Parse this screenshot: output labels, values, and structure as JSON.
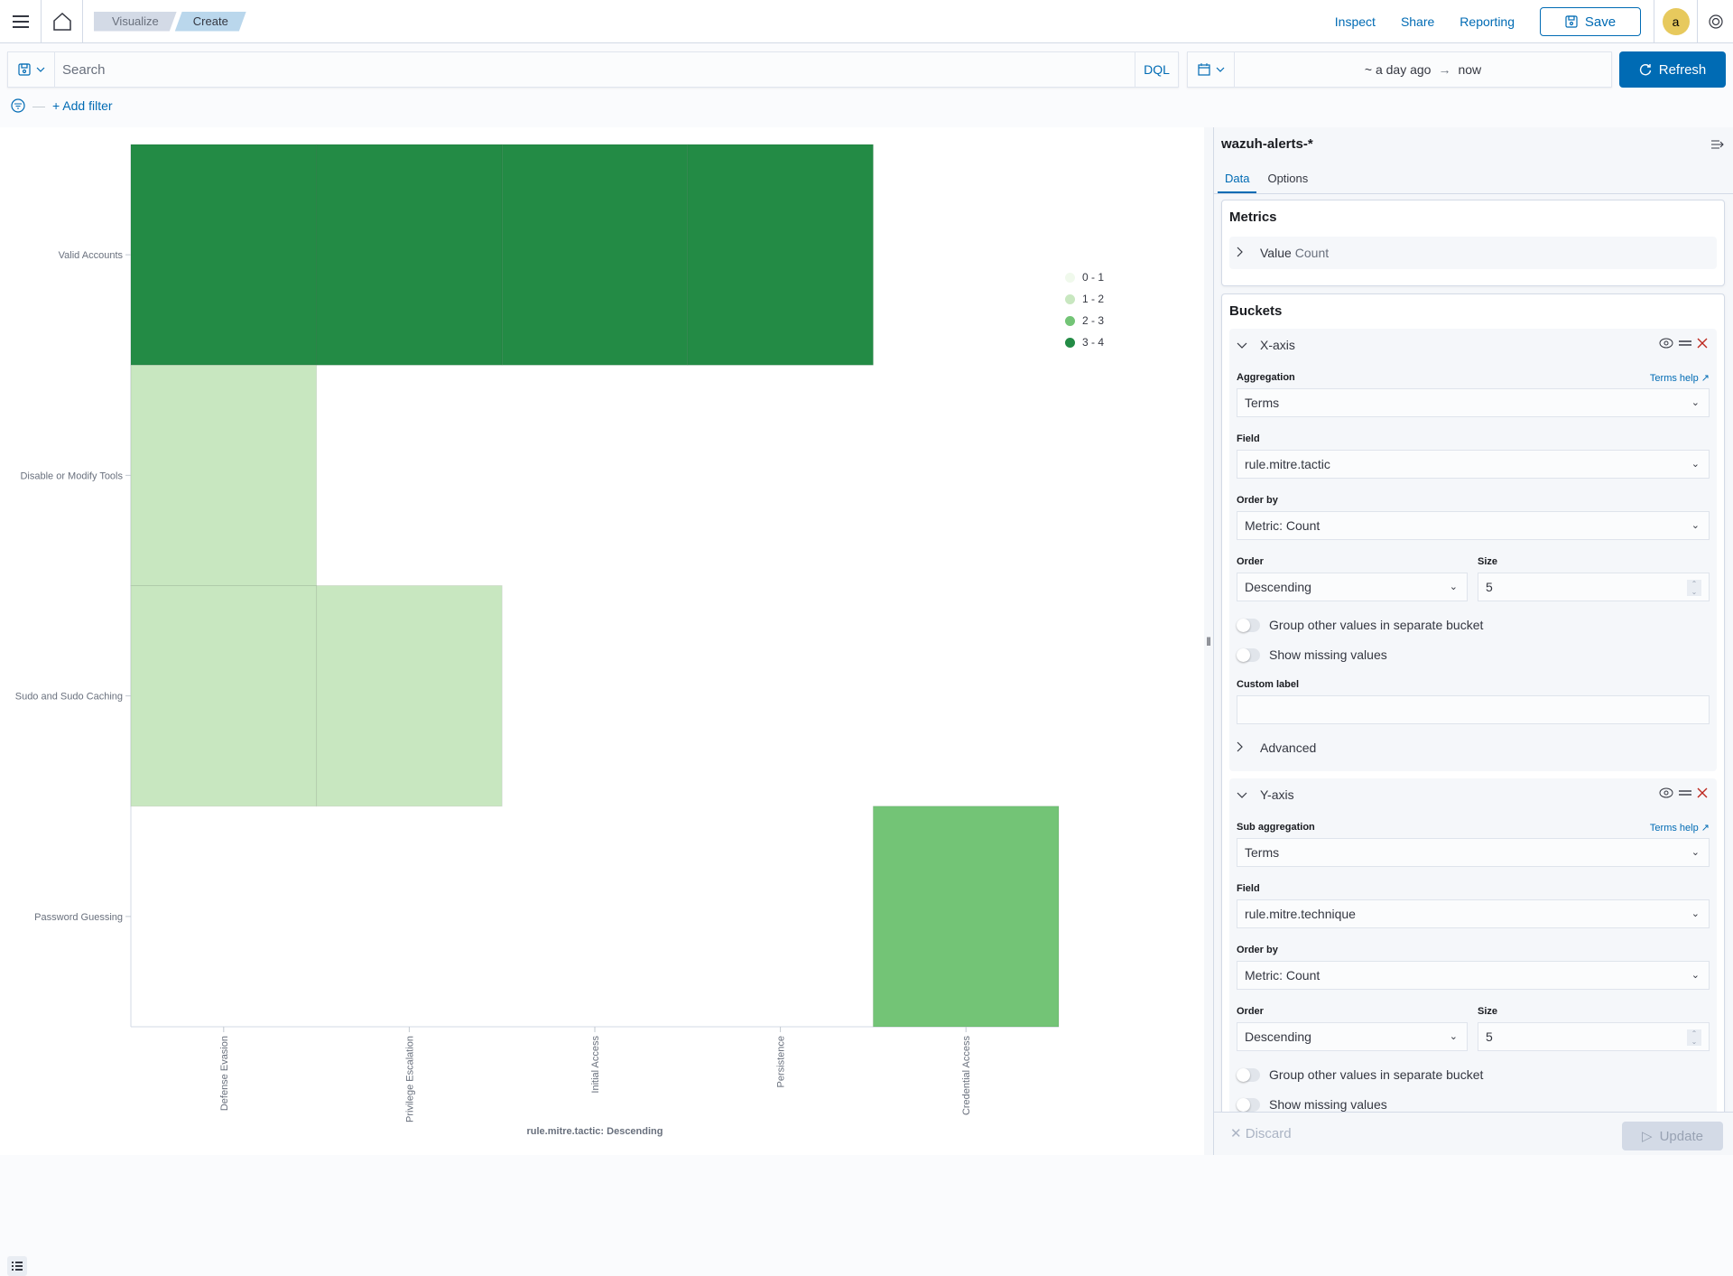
{
  "header": {
    "breadcrumbs": [
      "Visualize",
      "Create"
    ],
    "links": {
      "inspect": "Inspect",
      "share": "Share",
      "reporting": "Reporting"
    },
    "save_label": "Save",
    "avatar_initial": "a"
  },
  "query": {
    "search_placeholder": "Search",
    "search_value": "",
    "language": "DQL",
    "time_start": "~ a day ago",
    "time_arrow": "→",
    "time_end": "now",
    "refresh_label": "Refresh"
  },
  "filters": {
    "add_filter_label": "+ Add filter"
  },
  "panel": {
    "index_pattern": "wazuh-alerts-*",
    "tabs": [
      {
        "label": "Data",
        "active": true
      },
      {
        "label": "Options",
        "active": false
      }
    ],
    "metrics": {
      "title": "Metrics",
      "item_label": "Value",
      "item_type": "Count"
    },
    "buckets": {
      "title": "Buckets",
      "x_axis": {
        "title": "X-axis",
        "aggregation_label": "Aggregation",
        "help_link": "Terms help",
        "aggregation_value": "Terms",
        "field_label": "Field",
        "field_value": "rule.mitre.tactic",
        "order_by_label": "Order by",
        "order_by_value": "Metric: Count",
        "order_label": "Order",
        "order_value": "Descending",
        "size_label": "Size",
        "size_value": "5",
        "group_other_label": "Group other values in separate bucket",
        "group_other_on": false,
        "show_missing_label": "Show missing values",
        "show_missing_on": false,
        "custom_label_label": "Custom label",
        "custom_label_value": "",
        "advanced_label": "Advanced"
      },
      "y_axis": {
        "title": "Y-axis",
        "aggregation_label": "Sub aggregation",
        "help_link": "Terms help",
        "aggregation_value": "Terms",
        "field_label": "Field",
        "field_value": "rule.mitre.technique",
        "order_by_label": "Order by",
        "order_by_value": "Metric: Count",
        "order_label": "Order",
        "order_value": "Descending",
        "size_label": "Size",
        "size_value": "5",
        "group_other_label": "Group other values in separate bucket",
        "group_other_on": false,
        "show_missing_label": "Show missing values",
        "show_missing_on": false
      }
    },
    "footer": {
      "discard_label": "Discard",
      "update_label": "Update"
    }
  },
  "chart_data": {
    "type": "heatmap",
    "title": "",
    "xlabel": "rule.mitre.tactic: Descending",
    "ylabel": "",
    "x": [
      "Defense Evasion",
      "Privilege Escalation",
      "Initial Access",
      "Persistence",
      "Credential Access"
    ],
    "y": [
      "Valid Accounts",
      "Disable or Modify Tools",
      "Sudo and Sudo Caching",
      "Password Guessing"
    ],
    "values": [
      [
        4,
        4,
        4,
        4,
        null
      ],
      [
        2,
        null,
        null,
        null,
        null
      ],
      [
        2,
        2,
        null,
        null,
        null
      ],
      [
        null,
        null,
        null,
        null,
        3
      ]
    ],
    "value_note": "values read as color-bin upper bounds; bins per legend",
    "legend": {
      "position": "top-right",
      "bins": [
        {
          "label": "0 - 1",
          "min": 0,
          "max": 1,
          "color": "#f0f9ec"
        },
        {
          "label": "1 - 2",
          "min": 1,
          "max": 2,
          "color": "#c8e7c0"
        },
        {
          "label": "2 - 3",
          "min": 2,
          "max": 3,
          "color": "#73c476"
        },
        {
          "label": "3 - 4",
          "min": 3,
          "max": 4,
          "color": "#238b45"
        }
      ]
    },
    "grid": false
  }
}
